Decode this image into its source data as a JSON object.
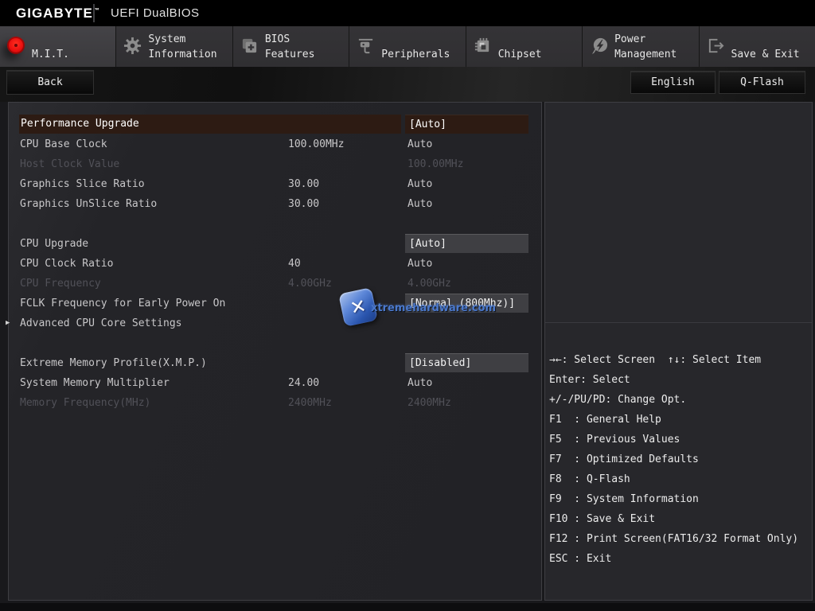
{
  "header": {
    "brand": "GIGABYTE",
    "brand_tm": "™",
    "title": "UEFI DualBIOS"
  },
  "tabs": [
    {
      "id": "mit",
      "lines": [
        "M.I.T."
      ],
      "icon": "mit-red-dot-icon",
      "active": true
    },
    {
      "id": "system-information",
      "lines": [
        "System",
        "Information"
      ],
      "icon": "gear-icon",
      "active": false
    },
    {
      "id": "bios-features",
      "lines": [
        "BIOS",
        "Features"
      ],
      "icon": "bios-plus-icon",
      "active": false
    },
    {
      "id": "peripherals",
      "lines": [
        "Peripherals"
      ],
      "icon": "peripherals-icon",
      "active": false
    },
    {
      "id": "chipset",
      "lines": [
        "Chipset"
      ],
      "icon": "chipset-icon",
      "active": false
    },
    {
      "id": "power-management",
      "lines": [
        "Power",
        "Management"
      ],
      "icon": "power-bolt-icon",
      "active": false
    },
    {
      "id": "save-exit",
      "lines": [
        "Save & Exit"
      ],
      "icon": "exit-door-icon",
      "active": false
    }
  ],
  "toolbar": {
    "back_label": "Back",
    "language_label": "English",
    "qflash_label": "Q-Flash"
  },
  "settings": {
    "rows": [
      {
        "label": "Performance Upgrade",
        "value": "[Auto]",
        "state": "selected"
      },
      {
        "label": "CPU Base Clock",
        "mid": "100.00MHz",
        "value": "Auto",
        "state": "normal"
      },
      {
        "label": "Host Clock Value",
        "value": "100.00MHz",
        "state": "dim"
      },
      {
        "label": "Graphics Slice Ratio",
        "mid": "30.00",
        "value": "Auto",
        "state": "normal"
      },
      {
        "label": "Graphics UnSlice Ratio",
        "mid": "30.00",
        "value": "Auto",
        "state": "normal"
      },
      {
        "spacer": true
      },
      {
        "label": "CPU Upgrade",
        "value": "[Auto]",
        "state": "boxed"
      },
      {
        "label": "CPU Clock Ratio",
        "mid": "40",
        "value": "Auto",
        "state": "normal"
      },
      {
        "label": "CPU Frequency",
        "mid": "4.00GHz",
        "value": "4.00GHz",
        "state": "dim"
      },
      {
        "label": "FCLK Frequency for Early Power On",
        "value": "[Normal (800Mhz)]",
        "state": "boxed"
      },
      {
        "label": "Advanced CPU Core Settings",
        "state": "submenu"
      },
      {
        "spacer": true
      },
      {
        "label": "Extreme Memory Profile(X.M.P.)",
        "value": "[Disabled]",
        "state": "boxed"
      },
      {
        "label": "System Memory Multiplier",
        "mid": "24.00",
        "value": "Auto",
        "state": "normal"
      },
      {
        "label": "Memory Frequency(MHz)",
        "mid": "2400MHz",
        "value": "2400MHz",
        "state": "dim"
      }
    ]
  },
  "help": {
    "lines": [
      "→←: Select Screen  ↑↓: Select Item",
      "Enter: Select",
      "+/-/PU/PD: Change Opt.",
      "F1  : General Help",
      "F5  : Previous Values",
      "F7  : Optimized Defaults",
      "F8  : Q-Flash",
      "F9  : System Information",
      "F10 : Save & Exit",
      "F12 : Print Screen(FAT16/32 Format Only)",
      "ESC : Exit"
    ]
  },
  "watermark": {
    "text": "xtremehardware.com",
    "x_glyph": "✕",
    "color": "#4a78cc"
  },
  "colors": {
    "highlight": "#2d1b13",
    "value_box": "#3f3f43",
    "accent_red": "#ea0f0f"
  }
}
